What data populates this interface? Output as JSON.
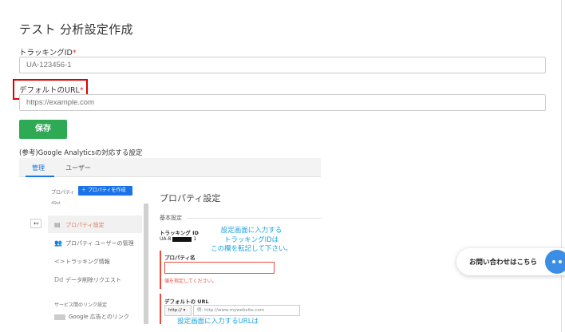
{
  "page": {
    "title": "テスト 分析設定作成",
    "accent_color": "#2eaa55"
  },
  "form": {
    "tracking_id": {
      "label": "トラッキングID",
      "required_mark": "*",
      "placeholder": "UA-123456-1"
    },
    "default_url": {
      "label": "デフォルトのURL",
      "required_mark": "*",
      "placeholder": "https://example.com"
    },
    "save_label": "保存"
  },
  "reference": {
    "caption": "(参考)Google Analyticsの対応する設定",
    "tabs": [
      {
        "label": "管理",
        "active": true
      },
      {
        "label": "ユーザー",
        "active": false
      }
    ],
    "left_panel": {
      "property_heading": "プロパティ",
      "create_property_label": "プロパティを作成",
      "property_id": "49st",
      "nav_items": [
        {
          "icon": "property-icon",
          "glyph": "▤",
          "label": "プロパティ設定"
        },
        {
          "icon": "users-icon",
          "glyph": "👥",
          "label": "プロパティ ユーザーの管理"
        },
        {
          "icon": "code-icon",
          "glyph": "<>",
          "label": "トラッキング情報"
        },
        {
          "icon": "data-deletion-icon",
          "glyph": "Dd",
          "label": "データ削除リクエスト"
        }
      ],
      "section_label": "サービス間のリンク設定",
      "link_item": "Google 広告とのリンク"
    },
    "right_panel": {
      "title": "プロパティ設定",
      "basic_settings": "基本設定",
      "tracking_id_label": "トラッキング ID",
      "tracking_id_prefix": "UA-8",
      "tracking_id_suffix": "1",
      "property_name_label": "プロパティ名",
      "property_name_error": "値を指定してください。",
      "default_url_label": "デフォルトの URL",
      "protocol_value": "http:// ▾",
      "url_placeholder": "例: http://www.mywebsite.com"
    },
    "annotation_1": [
      "設定画面に入力する",
      "トラッキングIDは",
      "この欄を転記して下さい。"
    ],
    "annotation_2": "設定画面に入力するURLは"
  },
  "contact": {
    "label": "お問い合わせはこちら",
    "icon": "chat-icon",
    "color": "#3a8ee6"
  }
}
